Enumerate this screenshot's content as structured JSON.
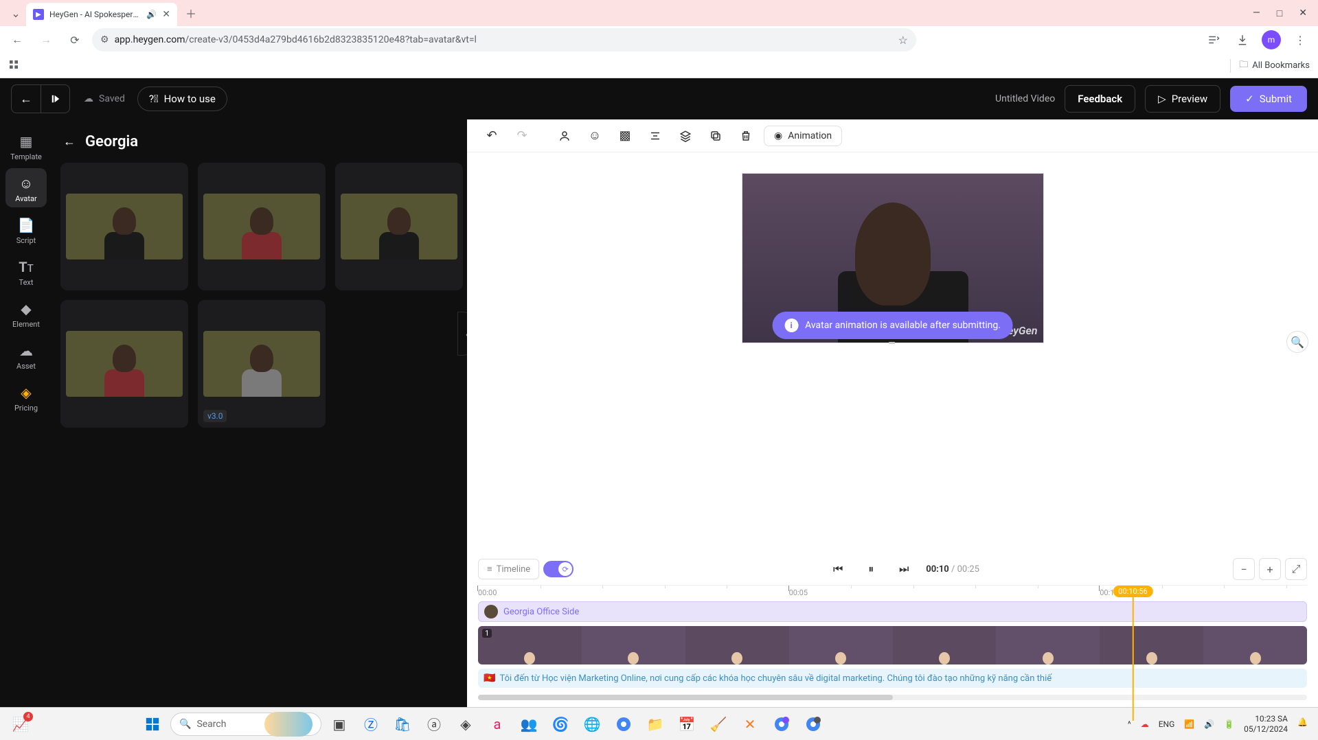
{
  "browser": {
    "tab_title": "HeyGen - AI Spokesperson",
    "url_domain": "app.heygen.com",
    "url_path": "/create-v3/0453d4a279bd4616b2d8323835120e48?tab=avatar&vt=l",
    "all_bookmarks": "All Bookmarks",
    "profile_initial": "m"
  },
  "header": {
    "saved": "Saved",
    "how_to": "How to use",
    "untitled": "Untitled Video",
    "feedback": "Feedback",
    "preview": "Preview",
    "submit": "Submit"
  },
  "sidenav": {
    "template": "Template",
    "avatar": "Avatar",
    "script": "Script",
    "text": "Text",
    "element": "Element",
    "asset": "Asset",
    "pricing": "Pricing"
  },
  "panel": {
    "title": "Georgia",
    "version_tag": "v3.0"
  },
  "toolbar": {
    "animation": "Animation"
  },
  "canvas": {
    "watermark": "HeyGen",
    "toast": "Avatar animation is available after submitting."
  },
  "timeline": {
    "label": "Timeline",
    "current": "00:10",
    "total": "00:25",
    "playhead": "00:10:56",
    "tick0": "00:00",
    "tick5": "00:05",
    "tick10": "00:10",
    "track_name": "Georgia Office Side",
    "frame_num": "1",
    "script_text": "Tôi đến từ Học viện Marketing Online, nơi cung cấp các khóa học chuyên sâu về digital marketing. Chúng tôi đào tạo những kỹ năng cần thiế"
  },
  "taskbar": {
    "search": "Search",
    "lang": "ENG",
    "time": "10:23 SA",
    "date": "05/12/2024",
    "badge": "4"
  }
}
